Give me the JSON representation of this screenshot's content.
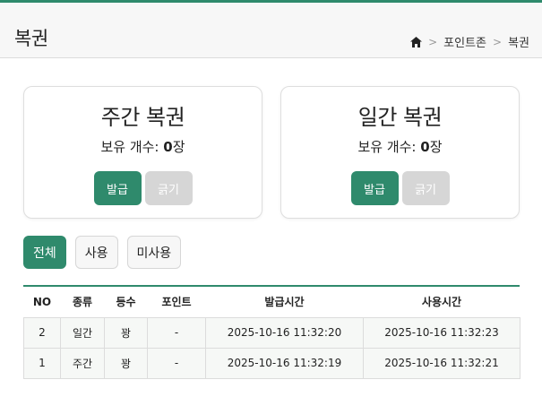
{
  "header": {
    "title": "복권",
    "breadcrumb": {
      "parent": "포인트존",
      "current": "복권",
      "separator": ">"
    }
  },
  "cards": {
    "weekly": {
      "title": "주간 복권",
      "count_label": "보유 개수: ",
      "count": "0",
      "count_unit": "장",
      "issue_label": "발급",
      "scratch_label": "긁기"
    },
    "daily": {
      "title": "일간 복권",
      "count_label": "보유 개수: ",
      "count": "0",
      "count_unit": "장",
      "issue_label": "발급",
      "scratch_label": "긁기"
    }
  },
  "filters": {
    "all": "전체",
    "used": "사용",
    "unused": "미사용"
  },
  "table": {
    "headers": [
      "NO",
      "종류",
      "등수",
      "포인트",
      "발급시간",
      "사용시간"
    ],
    "rows": [
      [
        "2",
        "일간",
        "꽝",
        "-",
        "2025-10-16 11:32:20",
        "2025-10-16 11:32:23"
      ],
      [
        "1",
        "주간",
        "꽝",
        "-",
        "2025-10-16 11:32:19",
        "2025-10-16 11:32:21"
      ]
    ]
  },
  "colors": {
    "accent": "#2f8a6c",
    "disabled": "#d6d6d6"
  },
  "icons": {
    "home": "home-icon"
  }
}
